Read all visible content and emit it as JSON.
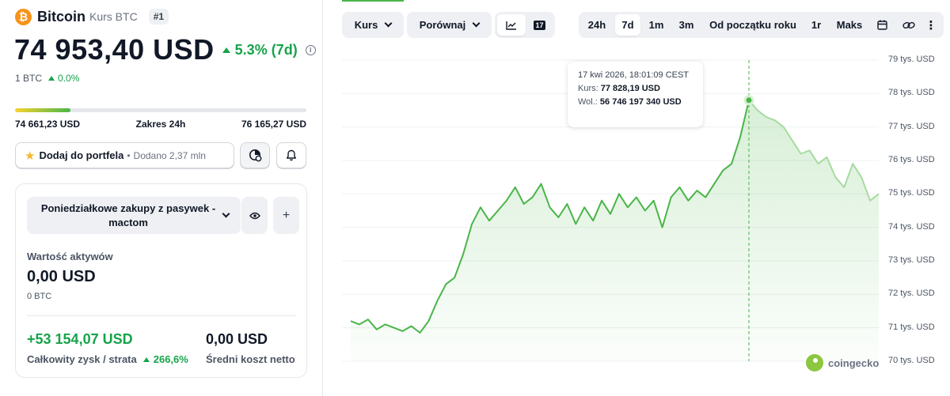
{
  "coin": {
    "logo_symbol": "₿",
    "name": "Bitcoin",
    "subtitle": "Kurs BTC",
    "rank": "#1",
    "price": "74 953,40 USD",
    "change": "5.3% (7d)",
    "btc_unit": "1 BTC",
    "btc_change": "0.0%"
  },
  "range24h": {
    "low": "74 661,23 USD",
    "label": "Zakres 24h",
    "high": "76 165,27 USD",
    "fill_fraction": 0.19
  },
  "actions": {
    "portfolio_label": "Dodaj do portfela",
    "separator": "•",
    "added": "Dodano 2,37 mln"
  },
  "portfolio": {
    "selected": "Poniedziałkowe zakupy z pasywek - mactom",
    "asset_value_label": "Wartość aktywów",
    "asset_value": "0,00 USD",
    "asset_btc": "0 BTC",
    "pnl_value": "+53 154,07 USD",
    "pnl_label": "Całkowity zysk / strata",
    "pnl_pct": "266,6%",
    "cost_value": "0,00 USD",
    "cost_label": "Średni koszt netto"
  },
  "toolbar": {
    "kurs": "Kurs",
    "compare": "Porównaj",
    "tv_logo": "17",
    "ranges": [
      "24h",
      "7d",
      "1m",
      "3m",
      "Od początku roku",
      "1r",
      "Maks"
    ],
    "active_range": "7d"
  },
  "tooltip": {
    "date": "17 kwi 2026, 18:01:09 CEST",
    "price_label": "Kurs:",
    "price_value": "77 828,19 USD",
    "volume_label": "Wol.:",
    "volume_value": "56 746 197 340 USD"
  },
  "watermark": "coingecko",
  "colors": {
    "accent_green": "#16a34a",
    "line_green": "#4ab548",
    "btc_orange": "#f7931a",
    "star_yellow": "#f5b82e"
  },
  "chart_data": {
    "type": "line",
    "ylim": [
      70,
      79
    ],
    "y_ticks": [
      {
        "value": 79,
        "label": "79 tys. USD"
      },
      {
        "value": 78,
        "label": "78 tys. USD"
      },
      {
        "value": 77,
        "label": "77 tys. USD"
      },
      {
        "value": 76,
        "label": "76 tys. USD"
      },
      {
        "value": 75,
        "label": "75 tys. USD"
      },
      {
        "value": 74,
        "label": "74 tys. USD"
      },
      {
        "value": 73,
        "label": "73 tys. USD"
      },
      {
        "value": 72,
        "label": "72 tys. USD"
      },
      {
        "value": 71,
        "label": "71 tys. USD"
      },
      {
        "value": 70,
        "label": "70 tys. USD"
      }
    ],
    "grid": true,
    "highlight_index": 46,
    "values": [
      71.2,
      71.1,
      71.25,
      70.95,
      71.1,
      71.0,
      70.9,
      71.05,
      70.85,
      71.2,
      71.8,
      72.3,
      72.5,
      73.2,
      74.1,
      74.6,
      74.2,
      74.5,
      74.8,
      75.2,
      74.7,
      74.9,
      75.3,
      74.6,
      74.3,
      74.7,
      74.1,
      74.6,
      74.2,
      74.8,
      74.4,
      75.0,
      74.6,
      74.9,
      74.5,
      74.8,
      74.0,
      74.9,
      75.2,
      74.8,
      75.1,
      74.9,
      75.3,
      75.7,
      75.9,
      76.7,
      77.8,
      77.5,
      77.3,
      77.2,
      77.0,
      76.6,
      76.2,
      76.3,
      75.9,
      76.1,
      75.5,
      75.2,
      75.9,
      75.5,
      74.8,
      75.0
    ]
  }
}
